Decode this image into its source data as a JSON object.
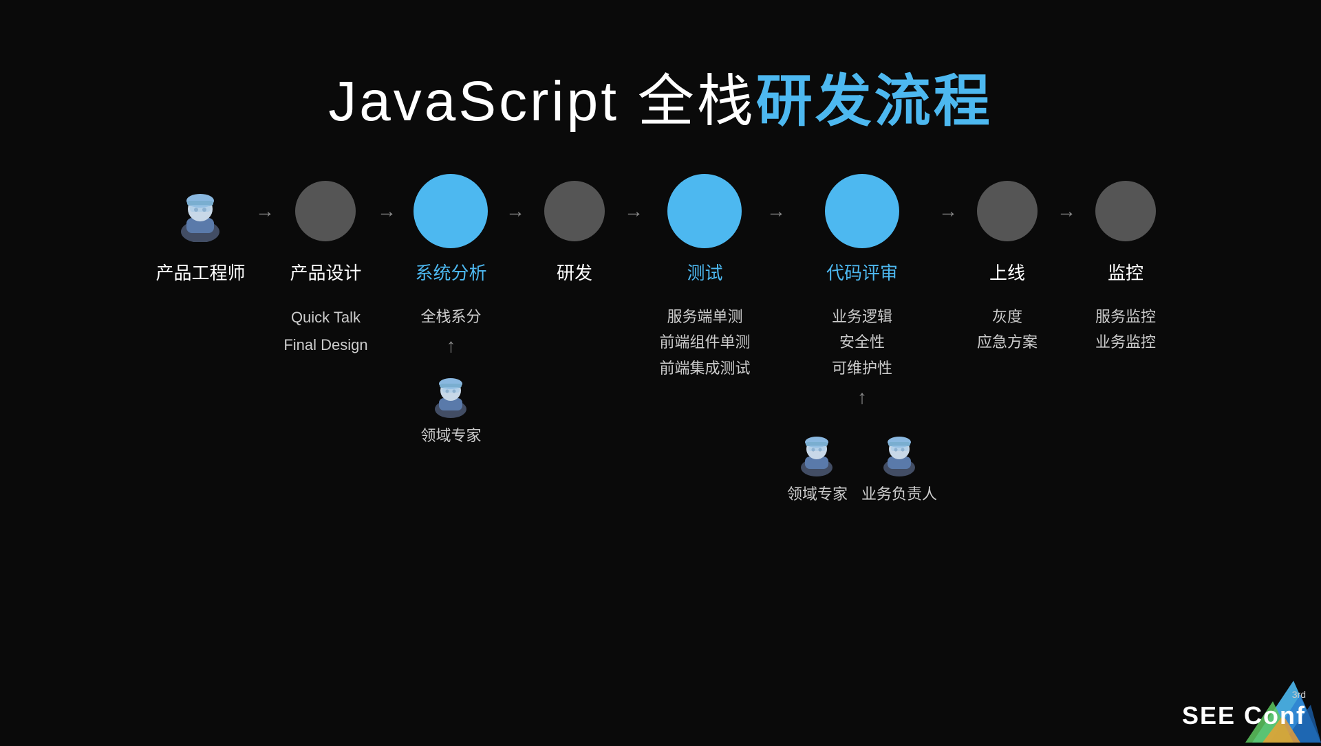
{
  "title": {
    "prefix": "JavaScript 全栈",
    "highlight": "研发流程"
  },
  "steps": [
    {
      "id": "product-engineer",
      "label": "产品工程师",
      "type": "person",
      "circleStyle": "none",
      "details": [],
      "bottomFigure": null
    },
    {
      "id": "product-design",
      "label": "产品设计",
      "type": "circle-gray",
      "circleStyle": "gray",
      "details": [
        "Quick Talk",
        "Final Design"
      ],
      "bottomFigure": null
    },
    {
      "id": "system-analysis",
      "label": "系统分析",
      "type": "circle-blue",
      "circleStyle": "blue-lg",
      "details": [
        "全栈系分"
      ],
      "bottomFigure": {
        "type": "person",
        "label": "领域专家",
        "arrowUp": true
      }
    },
    {
      "id": "dev",
      "label": "研发",
      "type": "circle-gray",
      "circleStyle": "gray",
      "details": [],
      "bottomFigure": null
    },
    {
      "id": "test",
      "label": "测试",
      "type": "circle-blue-lg",
      "circleStyle": "blue-lg",
      "details": [
        "服务端单测",
        "前端组件单测",
        "前端集成测试"
      ],
      "bottomFigure": null
    },
    {
      "id": "code-review",
      "label": "代码评审",
      "type": "circle-blue-lg",
      "circleStyle": "blue-lg",
      "details": [
        "业务逻辑",
        "安全性",
        "可维护性"
      ],
      "bottomFigures": [
        {
          "label": "领域专家"
        },
        {
          "label": "业务负责人"
        }
      ],
      "arrowUp": true
    },
    {
      "id": "online",
      "label": "上线",
      "type": "circle-gray",
      "circleStyle": "gray",
      "details": [
        "灰度",
        "应急方案"
      ],
      "bottomFigure": null
    },
    {
      "id": "monitor",
      "label": "监控",
      "type": "circle-gray",
      "circleStyle": "gray",
      "details": [
        "服务监控",
        "业务监控"
      ],
      "bottomFigure": null
    }
  ],
  "logo": {
    "text": "SEE Conf"
  }
}
